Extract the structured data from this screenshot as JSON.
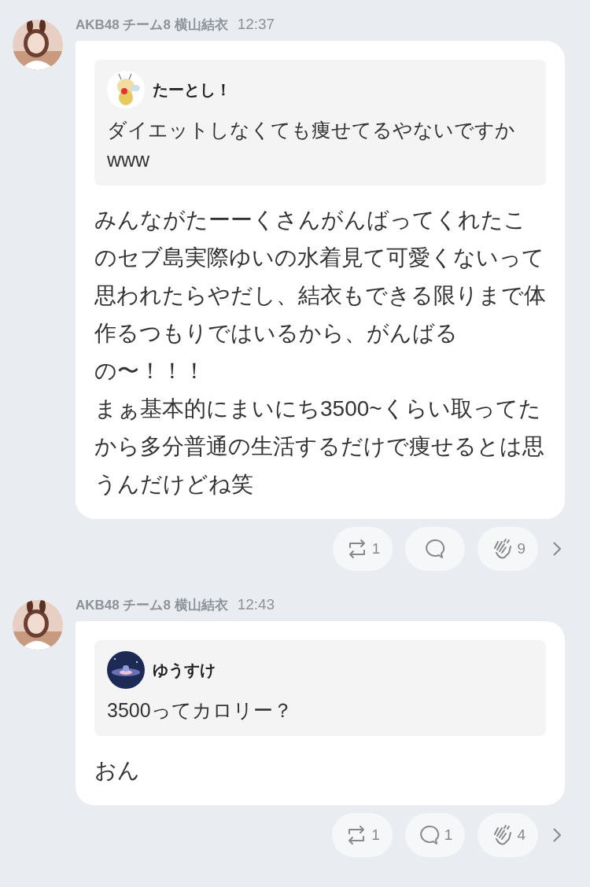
{
  "posts": [
    {
      "author": "AKB48 チーム8 横山結衣",
      "time": "12:37",
      "quote": {
        "name": "たーとし！",
        "text": "ダイエットしなくても痩せてるやないですかwww"
      },
      "paragraphs": [
        "みんながたーーくさんがんばってくれたこのセブ島実際ゆいの水着見て可愛くないって思われたらやだし、結衣もできる限りまで体作るつもりではいるから、がんばるの〜！！！",
        "まぁ基本的にまいにち3500~くらい取ってたから多分普通の生活するだけで痩せるとは思うんだけどね笑"
      ],
      "reactions": [
        {
          "kind": "repost",
          "count": "1"
        },
        {
          "kind": "comment"
        },
        {
          "kind": "clap",
          "count": "9"
        }
      ]
    },
    {
      "author": "AKB48 チーム8 横山結衣",
      "time": "12:43",
      "quote": {
        "name": "ゆうすけ",
        "text": "3500ってカロリー？"
      },
      "paragraphs": [
        "おん"
      ],
      "reactions": [
        {
          "kind": "repost",
          "count": "1"
        },
        {
          "kind": "comment",
          "count": "1"
        },
        {
          "kind": "clap",
          "count": "4"
        }
      ]
    }
  ]
}
